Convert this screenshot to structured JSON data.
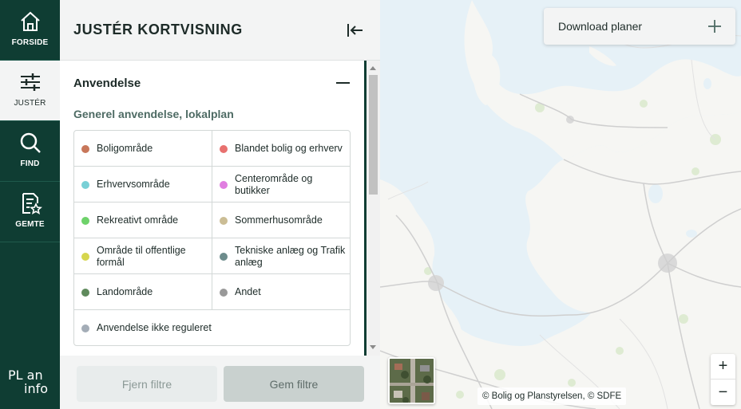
{
  "nav": {
    "items": [
      {
        "label": "FORSIDE",
        "icon": "home-icon"
      },
      {
        "label": "JUSTÉR",
        "icon": "sliders-icon"
      },
      {
        "label": "FIND",
        "icon": "search-icon"
      },
      {
        "label": "GEMTE",
        "icon": "saved-document-icon"
      }
    ],
    "active": "JUSTÉR",
    "logo_line1": "PL  an",
    "logo_line2": "info"
  },
  "panel": {
    "title": "JUSTÉR KORTVISNING",
    "section_title": "Anvendelse",
    "subsection_title": "Generel anvendelse, lokalplan",
    "legend": [
      {
        "label": "Boligområde",
        "color": "#c8775a"
      },
      {
        "label": "Blandet bolig og erhverv",
        "color": "#e8716f"
      },
      {
        "label": "Erhvervsområde",
        "color": "#78d0d6"
      },
      {
        "label": "Centerområde og butikker",
        "color": "#e07ee0"
      },
      {
        "label": "Rekreativt område",
        "color": "#6ed26a"
      },
      {
        "label": "Sommerhusområde",
        "color": "#cbbd95"
      },
      {
        "label": "Område til offentlige formål",
        "color": "#d6d64e"
      },
      {
        "label": "Tekniske anlæg og Trafik anlæg",
        "color": "#6d8c8c"
      },
      {
        "label": "Landområde",
        "color": "#5f8a5c"
      },
      {
        "label": "Andet",
        "color": "#999999"
      },
      {
        "label": "Anvendelse ikke reguleret",
        "color": "#a4adb7"
      }
    ],
    "remove_filters_label": "Fjern filtre",
    "save_filters_label": "Gem filtre"
  },
  "map": {
    "download_label": "Download planer",
    "attribution": "© Bolig og Planstyrelsen, © SDFE",
    "zoom_in_label": "+",
    "zoom_out_label": "−",
    "water_color": "#e6f1f7",
    "land_color": "#f6f6f3"
  }
}
